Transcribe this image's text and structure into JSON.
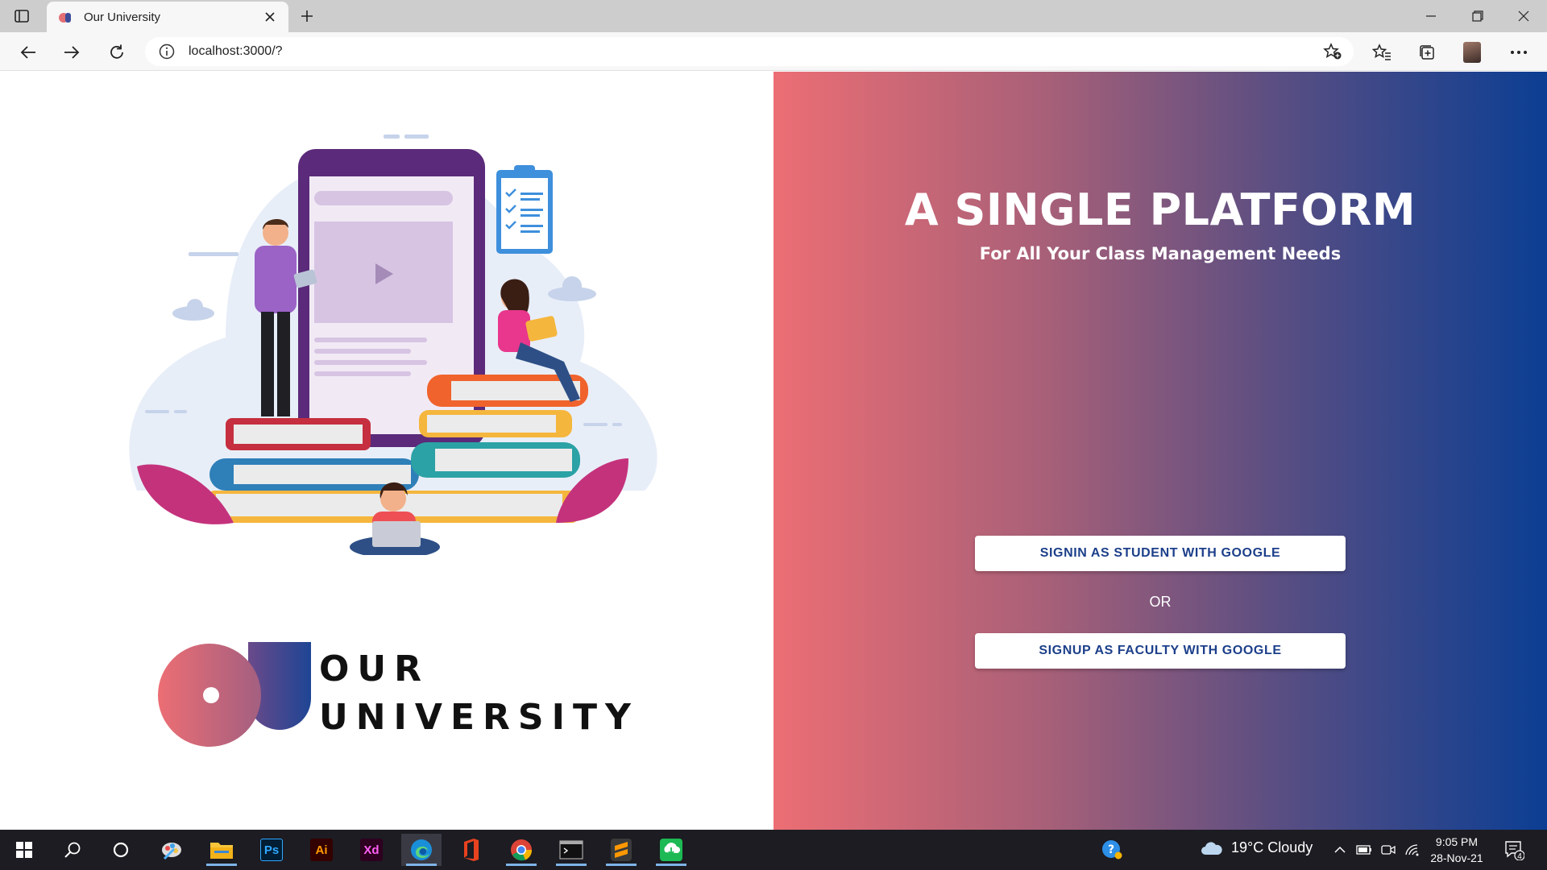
{
  "browser": {
    "tab_title": "Our University",
    "url": "localhost:3000/?"
  },
  "icons": {
    "tab_actions": "tab-actions-icon",
    "close": "close-icon",
    "new_tab": "plus-icon",
    "back": "back-arrow-icon",
    "forward": "forward-arrow-icon",
    "refresh": "refresh-icon",
    "info": "info-icon",
    "add_favorite": "star-add-icon",
    "favorites": "favorites-icon",
    "collections": "collections-icon",
    "profile": "profile-avatar",
    "more": "more-icon"
  },
  "colors": {
    "gradient_start": "#ec6e74",
    "gradient_end": "#0b3e93",
    "button_text": "#1c3f8a"
  },
  "logo": {
    "line1": "OUR",
    "line2": "UNIVERSITY"
  },
  "hero": {
    "title": "A SINGLE PLATFORM",
    "subtitle": "For All Your Class Management Needs"
  },
  "auth": {
    "student_button": "SIGNIN AS STUDENT WITH GOOGLE",
    "separator": "OR",
    "faculty_button": "SIGNUP AS FACULTY WITH GOOGLE"
  },
  "taskbar": {
    "apps": [
      "start",
      "search",
      "cortana",
      "paint-app",
      "file-explorer",
      "photoshop",
      "illustrator",
      "adobe-xd",
      "edge",
      "office",
      "chrome",
      "terminal",
      "sublime-text",
      "download-app"
    ],
    "ps_label": "Ps",
    "ai_label": "Ai",
    "xd_label": "Xd",
    "weather": "19°C  Cloudy",
    "time": "9:05 PM",
    "date": "28-Nov-21",
    "notification_count": "4"
  }
}
